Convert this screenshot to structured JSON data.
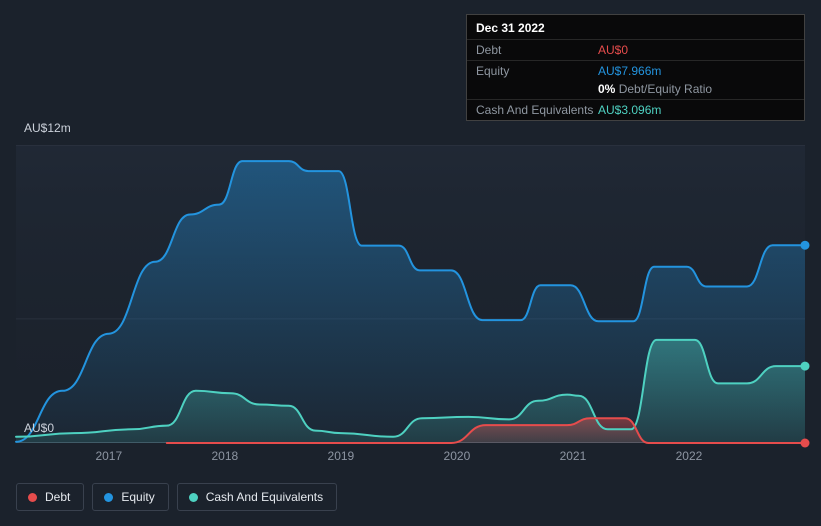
{
  "page": {
    "background": "#1b222c"
  },
  "tooltip": {
    "title": "Dec 31 2022",
    "debt": {
      "label": "Debt",
      "value": "AU$0"
    },
    "equity": {
      "label": "Equity",
      "value": "AU$7.966m"
    },
    "ratio": {
      "value": "0%",
      "label": "Debt/Equity Ratio"
    },
    "cash": {
      "label": "Cash And Equivalents",
      "value": "AU$3.096m"
    }
  },
  "legend": {
    "items": [
      {
        "label": "Debt",
        "series": "Debt"
      },
      {
        "label": "Equity",
        "series": "Equity"
      },
      {
        "label": "Cash And Equivalents",
        "series": "Cash And Equivalents"
      }
    ]
  },
  "chart_data": {
    "type": "area",
    "ylabel_top": "AU$12m",
    "ylabel_bottom": "AU$0",
    "ylim": [
      0,
      12
    ],
    "xlim": [
      2016.2,
      2023.0
    ],
    "gridlines": [
      12,
      5,
      0
    ],
    "legend_position": "bottom-left",
    "x_ticks": [
      {
        "label": "2017",
        "year": 2017
      },
      {
        "label": "2018",
        "year": 2018
      },
      {
        "label": "2019",
        "year": 2019
      },
      {
        "label": "2020",
        "year": 2020
      },
      {
        "label": "2021",
        "year": 2021
      },
      {
        "label": "2022",
        "year": 2022
      }
    ],
    "series": [
      {
        "name": "Equity",
        "color": "#2394df",
        "fill_top": 0.42,
        "fill_bottom": 0.04,
        "points": [
          [
            2016.2,
            0.05
          ],
          [
            2016.6,
            2.1
          ],
          [
            2017.0,
            4.4
          ],
          [
            2017.4,
            7.3
          ],
          [
            2017.7,
            9.2
          ],
          [
            2017.95,
            9.6
          ],
          [
            2018.15,
            11.35
          ],
          [
            2018.55,
            11.35
          ],
          [
            2018.72,
            10.95
          ],
          [
            2018.98,
            10.95
          ],
          [
            2019.18,
            7.95
          ],
          [
            2019.5,
            7.95
          ],
          [
            2019.68,
            6.95
          ],
          [
            2019.95,
            6.95
          ],
          [
            2020.22,
            4.95
          ],
          [
            2020.55,
            4.95
          ],
          [
            2020.72,
            6.35
          ],
          [
            2020.98,
            6.35
          ],
          [
            2021.22,
            4.9
          ],
          [
            2021.52,
            4.9
          ],
          [
            2021.7,
            7.1
          ],
          [
            2021.98,
            7.1
          ],
          [
            2022.15,
            6.3
          ],
          [
            2022.5,
            6.3
          ],
          [
            2022.72,
            7.966
          ],
          [
            2023.0,
            7.966
          ]
        ]
      },
      {
        "name": "Cash And Equivalents",
        "color": "#4ed1c1",
        "fill_top": 0.4,
        "fill_bottom": 0.12,
        "points": [
          [
            2016.2,
            0.25
          ],
          [
            2016.7,
            0.4
          ],
          [
            2017.2,
            0.55
          ],
          [
            2017.5,
            0.7
          ],
          [
            2017.75,
            2.1
          ],
          [
            2018.05,
            2.0
          ],
          [
            2018.3,
            1.55
          ],
          [
            2018.55,
            1.5
          ],
          [
            2018.78,
            0.5
          ],
          [
            2019.0,
            0.4
          ],
          [
            2019.45,
            0.25
          ],
          [
            2019.7,
            1.0
          ],
          [
            2020.1,
            1.05
          ],
          [
            2020.45,
            0.95
          ],
          [
            2020.7,
            1.7
          ],
          [
            2020.95,
            1.95
          ],
          [
            2021.05,
            1.9
          ],
          [
            2021.3,
            0.55
          ],
          [
            2021.5,
            0.55
          ],
          [
            2021.72,
            4.15
          ],
          [
            2022.05,
            4.15
          ],
          [
            2022.25,
            2.4
          ],
          [
            2022.5,
            2.4
          ],
          [
            2022.75,
            3.096
          ],
          [
            2023.0,
            3.096
          ]
        ]
      },
      {
        "name": "Debt",
        "color": "#e64c4c",
        "fill_top": 0.45,
        "fill_bottom": 0.15,
        "points": [
          [
            2017.5,
            0
          ],
          [
            2019.95,
            0
          ],
          [
            2020.25,
            0.72
          ],
          [
            2020.95,
            0.72
          ],
          [
            2021.15,
            1.0
          ],
          [
            2021.45,
            1.0
          ],
          [
            2021.65,
            0
          ],
          [
            2023.0,
            0
          ]
        ]
      }
    ]
  }
}
